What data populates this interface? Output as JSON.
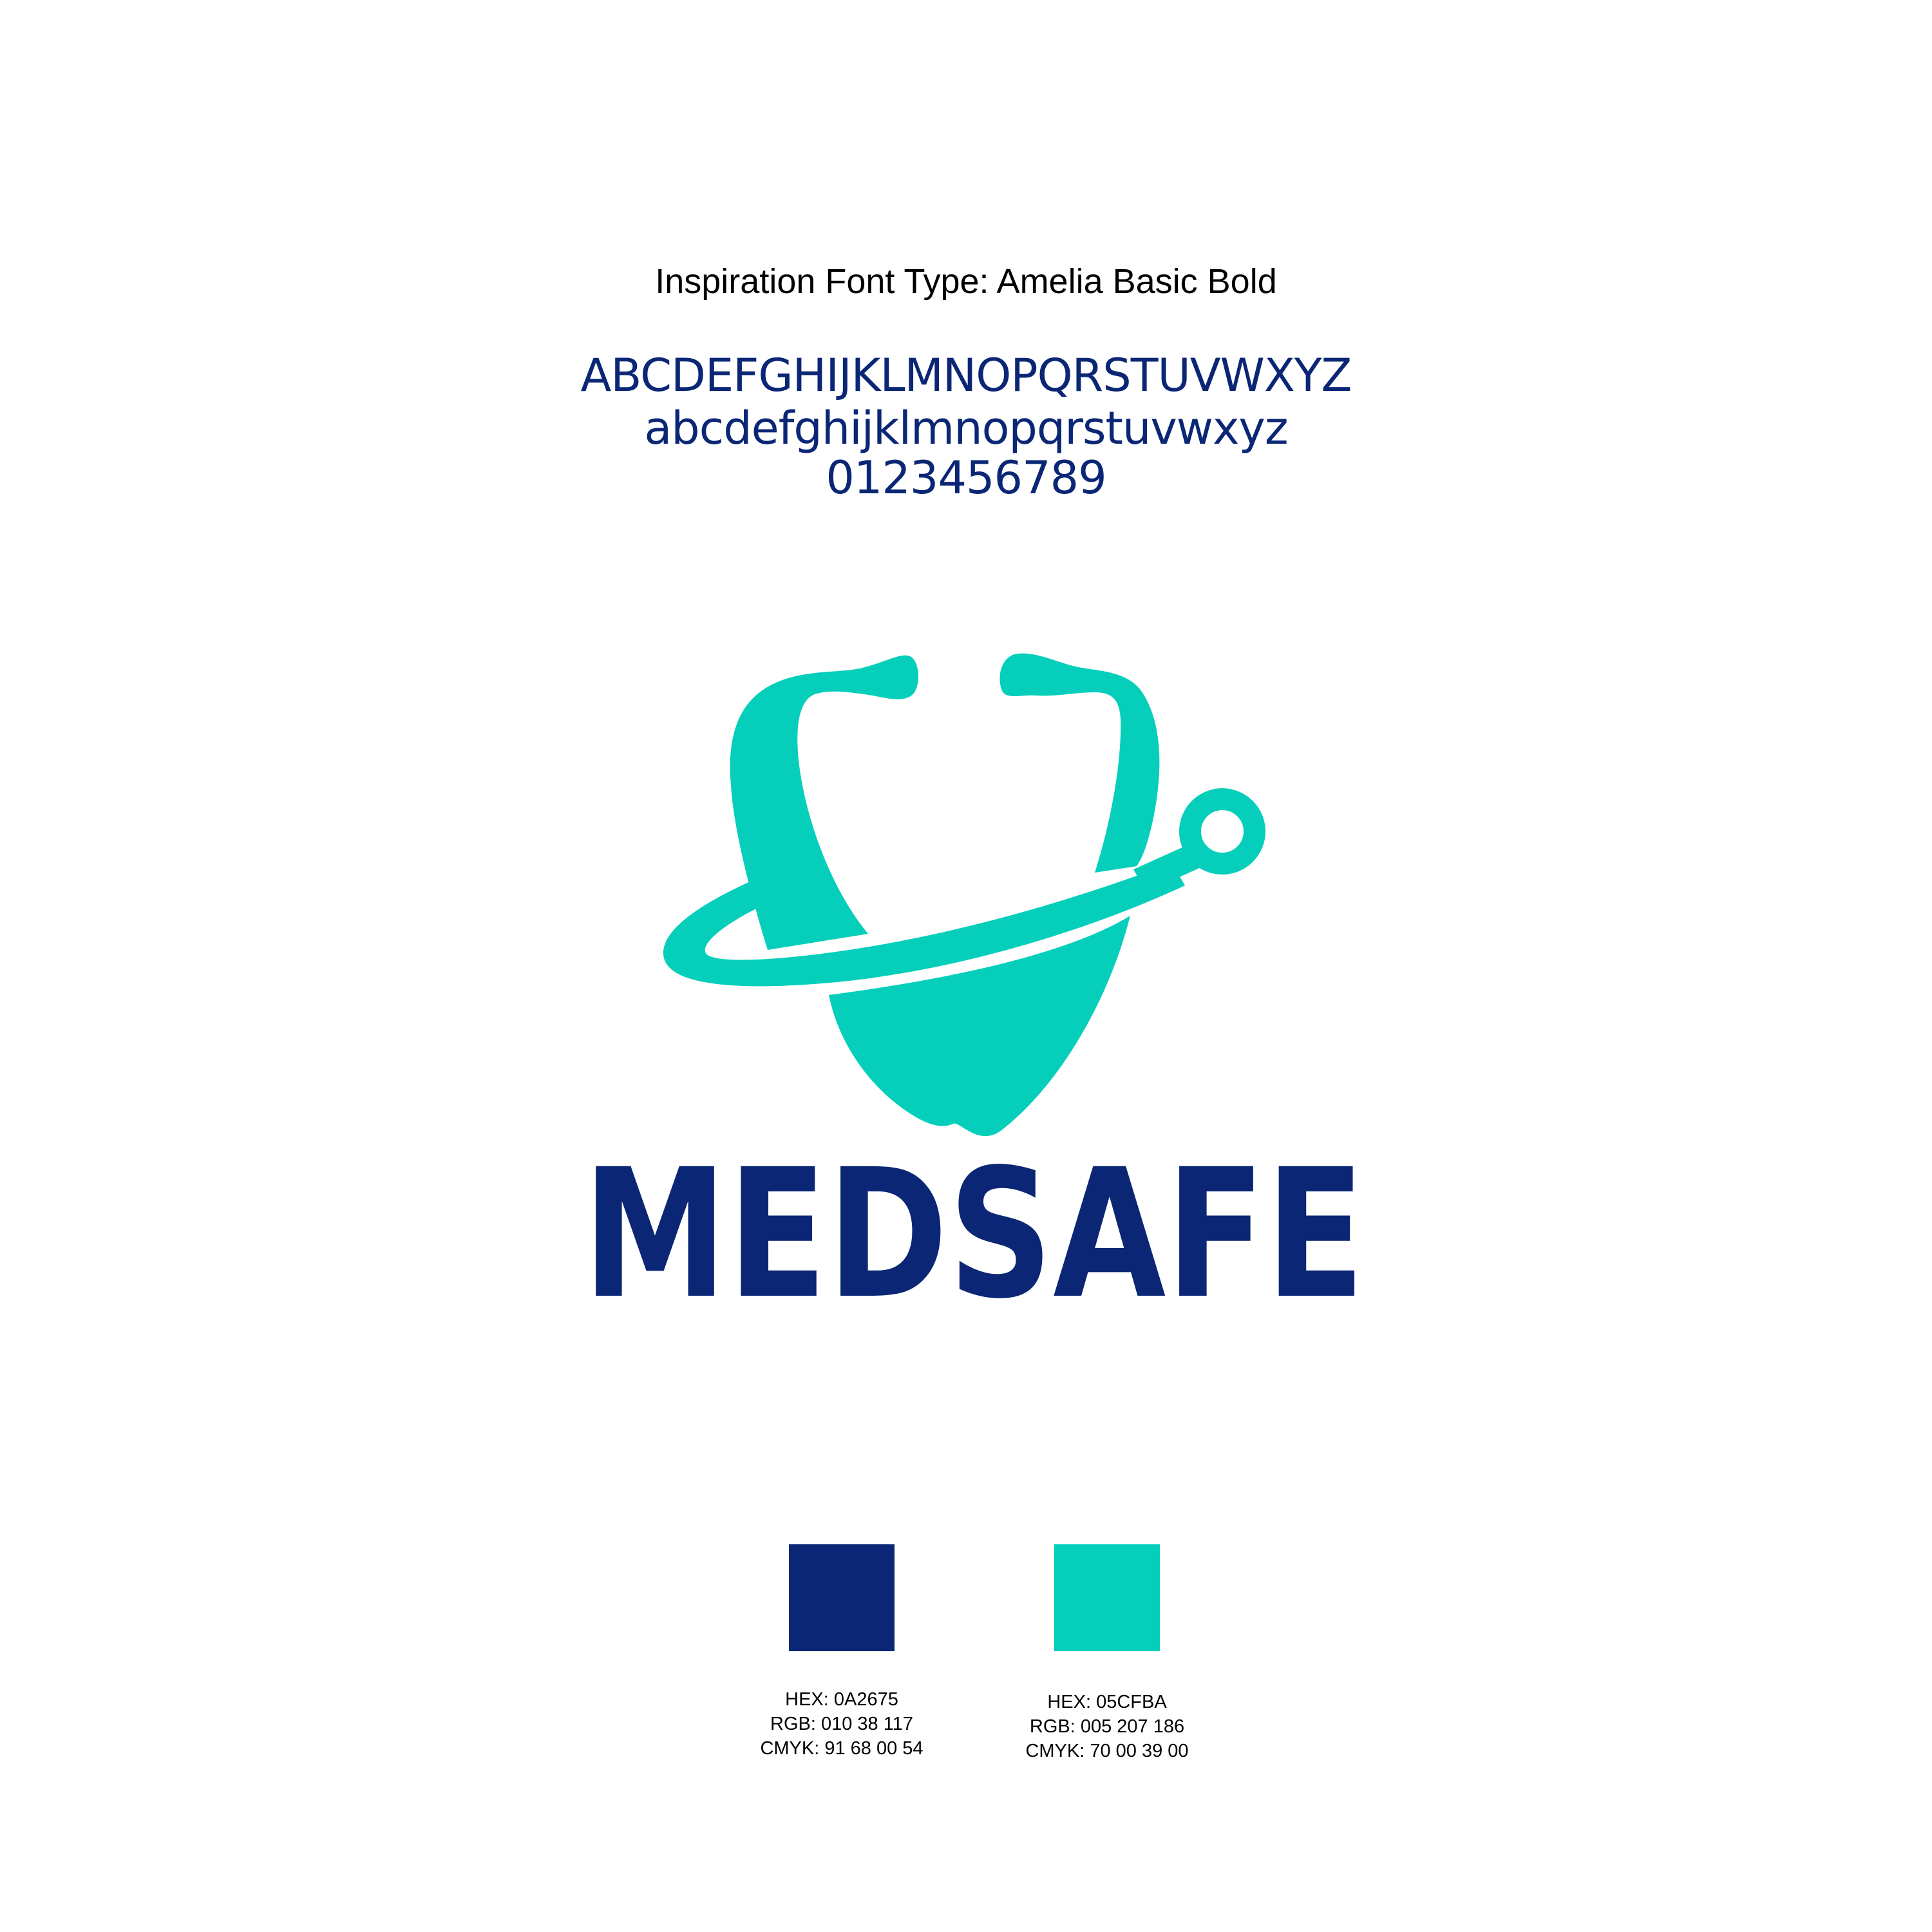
{
  "typography": {
    "inspiration_label": "Inspiration Font Type: Amelia Basic Bold",
    "uppercase": "ABCDEFGHIJKLMNOPQRSTUVWXYZ",
    "lowercase": "abcdefghijklmnopqrstuvwxyz",
    "digits": "0123456789"
  },
  "logo": {
    "wordmark": "MEDSAFE",
    "icon": "stethoscope-shield-icon",
    "colors": {
      "primary": "#0A2675",
      "accent": "#05CFBA"
    }
  },
  "palette": [
    {
      "color": "#0A2675",
      "hex": "HEX: 0A2675",
      "rgb": "RGB: 010 38 117",
      "cmyk": "CMYK: 91 68 00 54"
    },
    {
      "color": "#05CFBA",
      "hex": "HEX: 05CFBA",
      "rgb": "RGB: 005 207 186",
      "cmyk": "CMYK: 70 00 39 00"
    }
  ]
}
